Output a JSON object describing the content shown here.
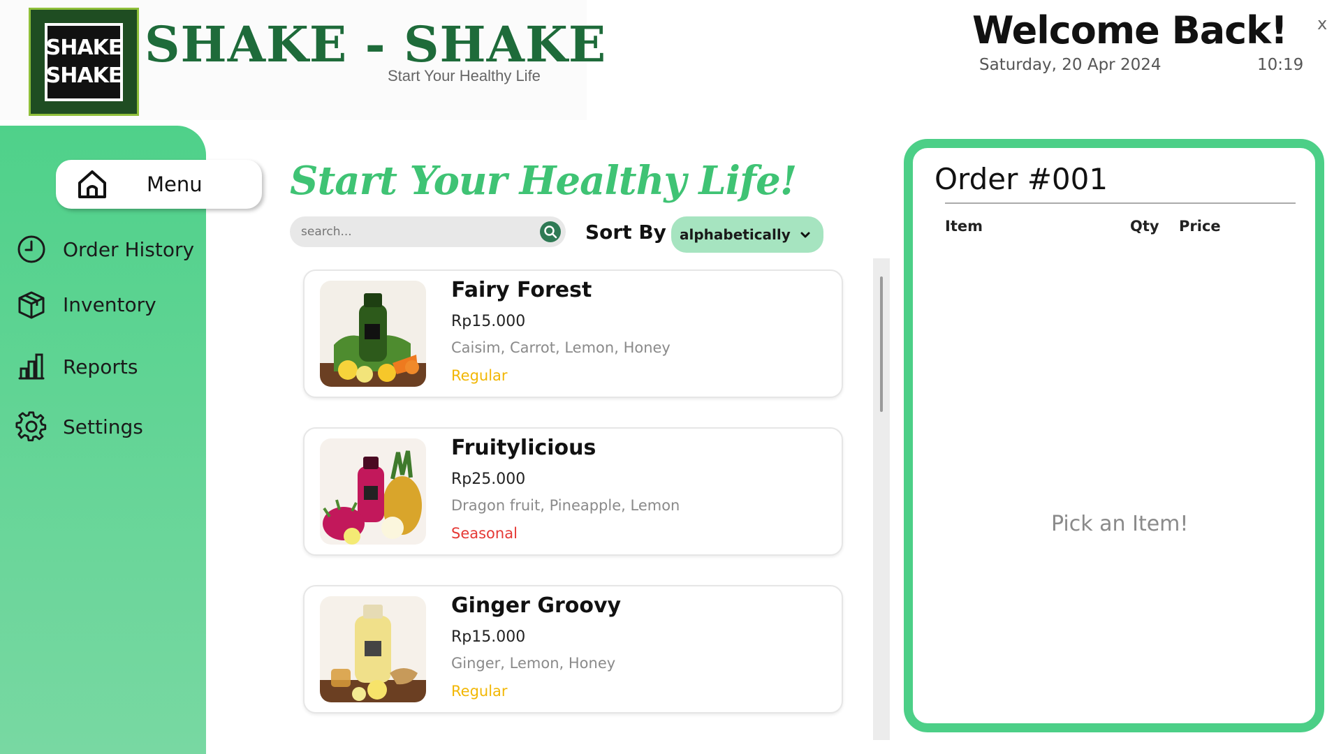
{
  "brand": {
    "title": "SHAKE - SHAKE",
    "tagline": "Start Your Healthy Life",
    "logo_line1": "SHAKE",
    "logo_line2": "SHAKE"
  },
  "header": {
    "welcome": "Welcome Back!",
    "date": "Saturday, 20 Apr 2024",
    "time": "10:19",
    "close_label": "x"
  },
  "sidebar": {
    "menu_label": "Menu",
    "items": [
      {
        "label": "Order History",
        "icon": "clock-icon"
      },
      {
        "label": "Inventory",
        "icon": "box-icon"
      },
      {
        "label": "Reports",
        "icon": "bar-chart-icon"
      },
      {
        "label": "Settings",
        "icon": "gear-icon"
      }
    ]
  },
  "main": {
    "headline": "Start Your Healthy Life!",
    "search_placeholder": "search...",
    "sort_label": "Sort By",
    "sort_value": "alphabetically"
  },
  "products": [
    {
      "name": "Fairy Forest",
      "price": "Rp15.000",
      "ingredients": "Caisim, Carrot, Lemon, Honey",
      "tag": "Regular",
      "tag_color": "#f2b705"
    },
    {
      "name": "Fruitylicious",
      "price": "Rp25.000",
      "ingredients": "Dragon fruit, Pineapple, Lemon",
      "tag": "Seasonal",
      "tag_color": "#e53935"
    },
    {
      "name": "Ginger Groovy",
      "price": "Rp15.000",
      "ingredients": "Ginger, Lemon, Honey",
      "tag": "Regular",
      "tag_color": "#f2b705"
    }
  ],
  "order": {
    "title": "Order #001",
    "col_item": "Item",
    "col_qty": "Qty",
    "col_price": "Price",
    "empty_message": "Pick an Item!"
  },
  "colors": {
    "accent": "#4ccf87",
    "brand_green": "#1e6b3a",
    "headline_green": "#3fc374",
    "regular_tag": "#f2b705",
    "seasonal_tag": "#e53935"
  }
}
